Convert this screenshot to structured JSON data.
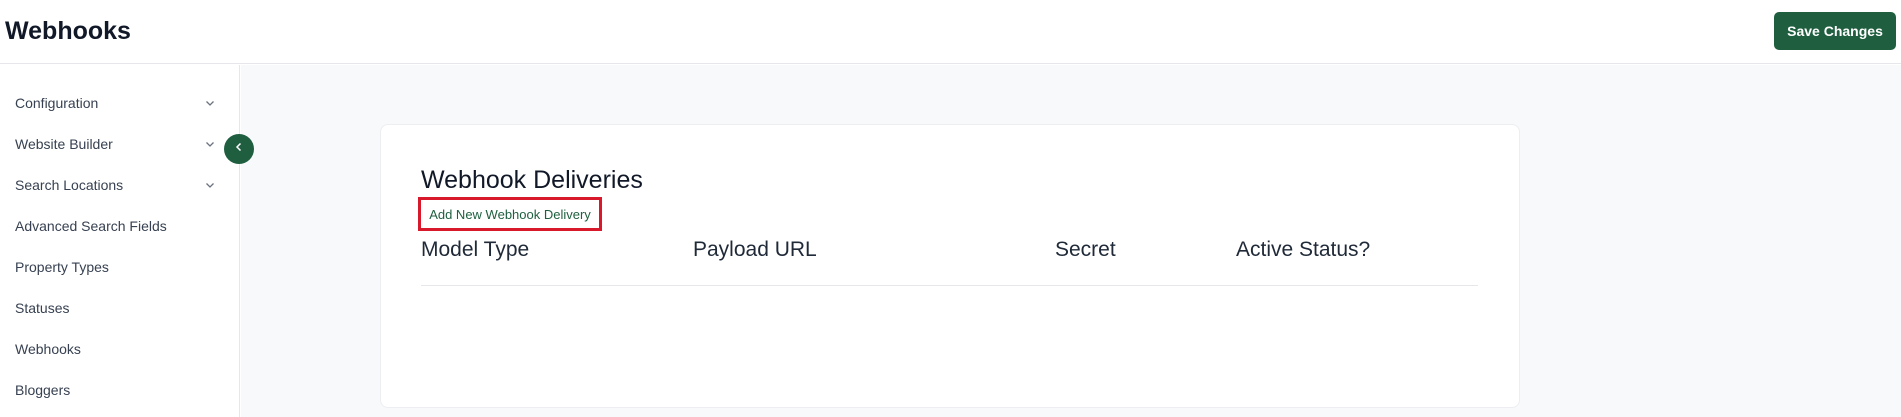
{
  "header": {
    "title": "Webhooks",
    "save_label": "Save Changes"
  },
  "sidebar": {
    "items": [
      {
        "label": "Configuration",
        "has_chevron": true
      },
      {
        "label": "Website Builder",
        "has_chevron": true
      },
      {
        "label": "Search Locations",
        "has_chevron": true
      },
      {
        "label": "Advanced Search Fields",
        "has_chevron": false
      },
      {
        "label": "Property Types",
        "has_chevron": false
      },
      {
        "label": "Statuses",
        "has_chevron": false
      },
      {
        "label": "Webhooks",
        "has_chevron": false
      },
      {
        "label": "Bloggers",
        "has_chevron": false
      }
    ],
    "collapse_icon": "chevron-left-icon"
  },
  "card": {
    "title": "Webhook Deliveries",
    "add_link": "Add New Webhook Delivery",
    "columns": [
      "Model Type",
      "Payload URL",
      "Secret",
      "Active Status?"
    ],
    "rows": []
  },
  "colors": {
    "accent": "#1f5f3f",
    "highlight": "#d7192b",
    "background": "#f8f9fa"
  }
}
